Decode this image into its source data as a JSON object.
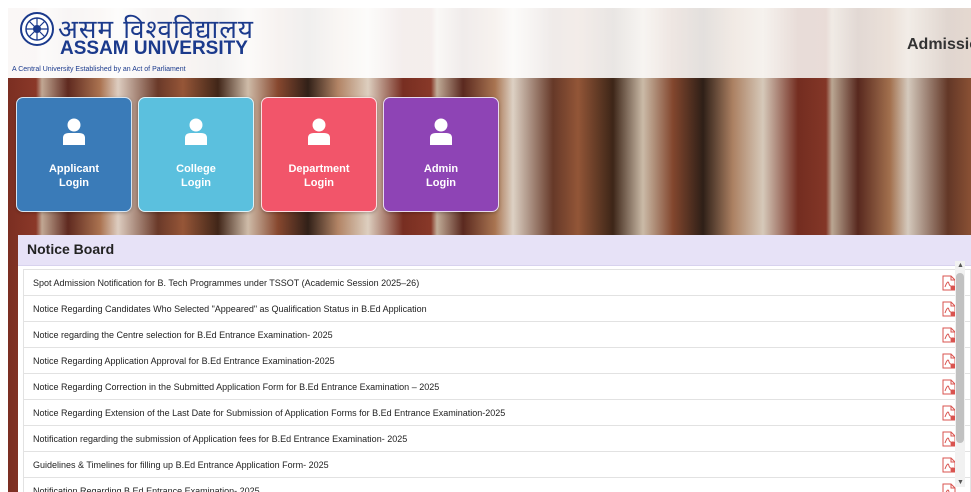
{
  "header": {
    "hindi_name": "असम विश्वविद्यालय",
    "english_name": "ASSAM UNIVERSITY",
    "tagline": "A Central University Established by an Act of Parliament",
    "right_title": "Admissio"
  },
  "login_tiles": [
    {
      "line1": "Applicant",
      "line2": "Login",
      "color": "#3a7bb8",
      "icon": "user-icon"
    },
    {
      "line1": "College",
      "line2": "Login",
      "color": "#5bc0de",
      "icon": "user-icon"
    },
    {
      "line1": "Department",
      "line2": "Login",
      "color": "#f2556a",
      "icon": "user-icon"
    },
    {
      "line1": "Admin",
      "line2": "Login",
      "color": "#8e44b5",
      "icon": "user-icon"
    }
  ],
  "notice_board": {
    "title": "Notice Board",
    "items": [
      "Spot Admission Notification for B. Tech Programmes under TSSOT (Academic Session 2025–26)",
      "Notice Regarding Candidates Who Selected \"Appeared\" as Qualification Status in B.Ed Application",
      "Notice regarding the Centre selection for B.Ed Entrance Examination- 2025",
      "Notice Regarding Application Approval for B.Ed Entrance Examination-2025",
      "Notice Regarding Correction in the Submitted Application Form for B.Ed Entrance Examination – 2025",
      "Notice Regarding Extension of the Last Date for Submission of Application Forms for B.Ed Entrance Examination-2025",
      "Notification regarding the submission of Application fees for B.Ed Entrance Examination- 2025",
      "Guidelines & Timelines for filling up B.Ed Entrance Application Form- 2025",
      "Notification Regarding B.Ed Entrance Examination- 2025"
    ],
    "item_icon": "pdf-icon"
  }
}
